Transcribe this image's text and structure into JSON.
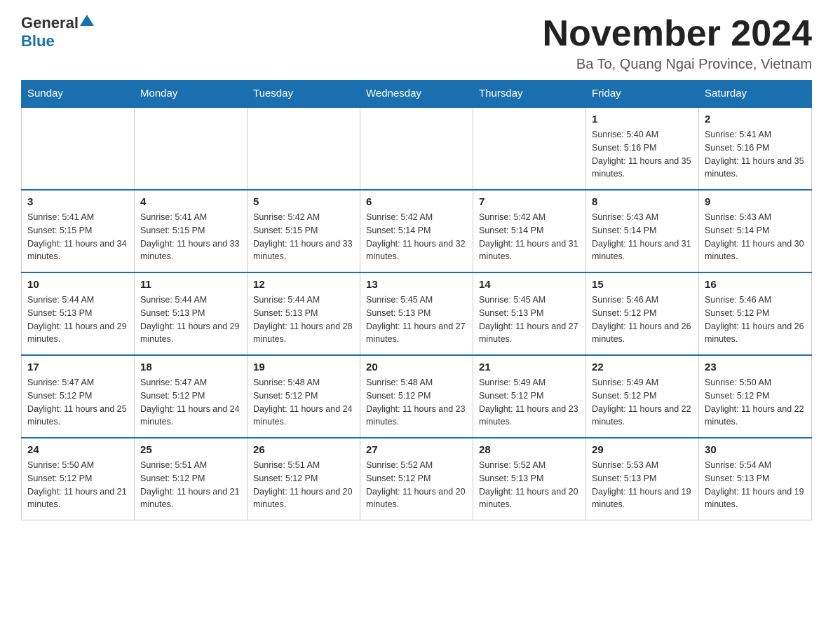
{
  "header": {
    "logo_general": "General",
    "logo_blue": "Blue",
    "month_title": "November 2024",
    "location": "Ba To, Quang Ngai Province, Vietnam"
  },
  "weekdays": [
    "Sunday",
    "Monday",
    "Tuesday",
    "Wednesday",
    "Thursday",
    "Friday",
    "Saturday"
  ],
  "weeks": [
    [
      {
        "day": "",
        "info": ""
      },
      {
        "day": "",
        "info": ""
      },
      {
        "day": "",
        "info": ""
      },
      {
        "day": "",
        "info": ""
      },
      {
        "day": "",
        "info": ""
      },
      {
        "day": "1",
        "info": "Sunrise: 5:40 AM\nSunset: 5:16 PM\nDaylight: 11 hours and 35 minutes."
      },
      {
        "day": "2",
        "info": "Sunrise: 5:41 AM\nSunset: 5:16 PM\nDaylight: 11 hours and 35 minutes."
      }
    ],
    [
      {
        "day": "3",
        "info": "Sunrise: 5:41 AM\nSunset: 5:15 PM\nDaylight: 11 hours and 34 minutes."
      },
      {
        "day": "4",
        "info": "Sunrise: 5:41 AM\nSunset: 5:15 PM\nDaylight: 11 hours and 33 minutes."
      },
      {
        "day": "5",
        "info": "Sunrise: 5:42 AM\nSunset: 5:15 PM\nDaylight: 11 hours and 33 minutes."
      },
      {
        "day": "6",
        "info": "Sunrise: 5:42 AM\nSunset: 5:14 PM\nDaylight: 11 hours and 32 minutes."
      },
      {
        "day": "7",
        "info": "Sunrise: 5:42 AM\nSunset: 5:14 PM\nDaylight: 11 hours and 31 minutes."
      },
      {
        "day": "8",
        "info": "Sunrise: 5:43 AM\nSunset: 5:14 PM\nDaylight: 11 hours and 31 minutes."
      },
      {
        "day": "9",
        "info": "Sunrise: 5:43 AM\nSunset: 5:14 PM\nDaylight: 11 hours and 30 minutes."
      }
    ],
    [
      {
        "day": "10",
        "info": "Sunrise: 5:44 AM\nSunset: 5:13 PM\nDaylight: 11 hours and 29 minutes."
      },
      {
        "day": "11",
        "info": "Sunrise: 5:44 AM\nSunset: 5:13 PM\nDaylight: 11 hours and 29 minutes."
      },
      {
        "day": "12",
        "info": "Sunrise: 5:44 AM\nSunset: 5:13 PM\nDaylight: 11 hours and 28 minutes."
      },
      {
        "day": "13",
        "info": "Sunrise: 5:45 AM\nSunset: 5:13 PM\nDaylight: 11 hours and 27 minutes."
      },
      {
        "day": "14",
        "info": "Sunrise: 5:45 AM\nSunset: 5:13 PM\nDaylight: 11 hours and 27 minutes."
      },
      {
        "day": "15",
        "info": "Sunrise: 5:46 AM\nSunset: 5:12 PM\nDaylight: 11 hours and 26 minutes."
      },
      {
        "day": "16",
        "info": "Sunrise: 5:46 AM\nSunset: 5:12 PM\nDaylight: 11 hours and 26 minutes."
      }
    ],
    [
      {
        "day": "17",
        "info": "Sunrise: 5:47 AM\nSunset: 5:12 PM\nDaylight: 11 hours and 25 minutes."
      },
      {
        "day": "18",
        "info": "Sunrise: 5:47 AM\nSunset: 5:12 PM\nDaylight: 11 hours and 24 minutes."
      },
      {
        "day": "19",
        "info": "Sunrise: 5:48 AM\nSunset: 5:12 PM\nDaylight: 11 hours and 24 minutes."
      },
      {
        "day": "20",
        "info": "Sunrise: 5:48 AM\nSunset: 5:12 PM\nDaylight: 11 hours and 23 minutes."
      },
      {
        "day": "21",
        "info": "Sunrise: 5:49 AM\nSunset: 5:12 PM\nDaylight: 11 hours and 23 minutes."
      },
      {
        "day": "22",
        "info": "Sunrise: 5:49 AM\nSunset: 5:12 PM\nDaylight: 11 hours and 22 minutes."
      },
      {
        "day": "23",
        "info": "Sunrise: 5:50 AM\nSunset: 5:12 PM\nDaylight: 11 hours and 22 minutes."
      }
    ],
    [
      {
        "day": "24",
        "info": "Sunrise: 5:50 AM\nSunset: 5:12 PM\nDaylight: 11 hours and 21 minutes."
      },
      {
        "day": "25",
        "info": "Sunrise: 5:51 AM\nSunset: 5:12 PM\nDaylight: 11 hours and 21 minutes."
      },
      {
        "day": "26",
        "info": "Sunrise: 5:51 AM\nSunset: 5:12 PM\nDaylight: 11 hours and 20 minutes."
      },
      {
        "day": "27",
        "info": "Sunrise: 5:52 AM\nSunset: 5:12 PM\nDaylight: 11 hours and 20 minutes."
      },
      {
        "day": "28",
        "info": "Sunrise: 5:52 AM\nSunset: 5:13 PM\nDaylight: 11 hours and 20 minutes."
      },
      {
        "day": "29",
        "info": "Sunrise: 5:53 AM\nSunset: 5:13 PM\nDaylight: 11 hours and 19 minutes."
      },
      {
        "day": "30",
        "info": "Sunrise: 5:54 AM\nSunset: 5:13 PM\nDaylight: 11 hours and 19 minutes."
      }
    ]
  ]
}
